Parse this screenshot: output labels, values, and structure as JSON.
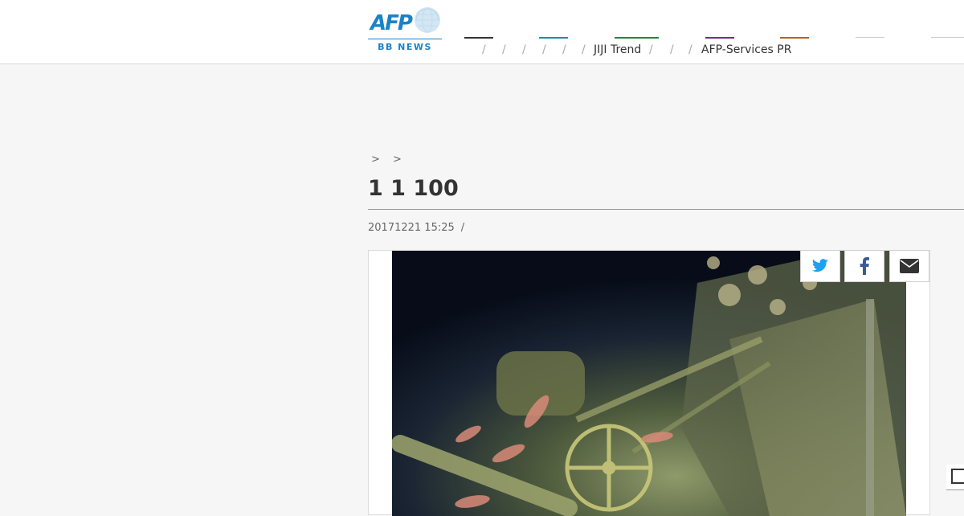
{
  "header": {
    "logo": {
      "wordmark": "AFP",
      "subtitle": "BB NEWS",
      "brand_color": "#1b82c6"
    },
    "nav_bars": [
      {
        "color": "#333333"
      },
      {
        "color": "#1a8fa8"
      },
      {
        "color": "#1f8a3c"
      },
      {
        "color": "#7a2a8c"
      },
      {
        "color": "#b7651f"
      },
      {
        "color": "#cccccc"
      },
      {
        "color": "#cccccc"
      }
    ],
    "nav_links": {
      "jiji_trend": "JIJI Trend",
      "afp_services": "AFP-Services PR"
    },
    "nav_separator": "/"
  },
  "article": {
    "breadcrumb": [
      ">",
      ">"
    ],
    "title": "1 1 100",
    "date": "20171221 15:25",
    "meta_separator": "/"
  },
  "share": {
    "twitter": {
      "icon": "twitter-icon",
      "color": "#1da1f2"
    },
    "facebook": {
      "icon": "facebook-icon",
      "color": "#3b5998"
    },
    "email": {
      "icon": "envelope-icon",
      "color": "#333333"
    }
  },
  "photo": {
    "subject": "underwater-shipwreck-photo"
  }
}
